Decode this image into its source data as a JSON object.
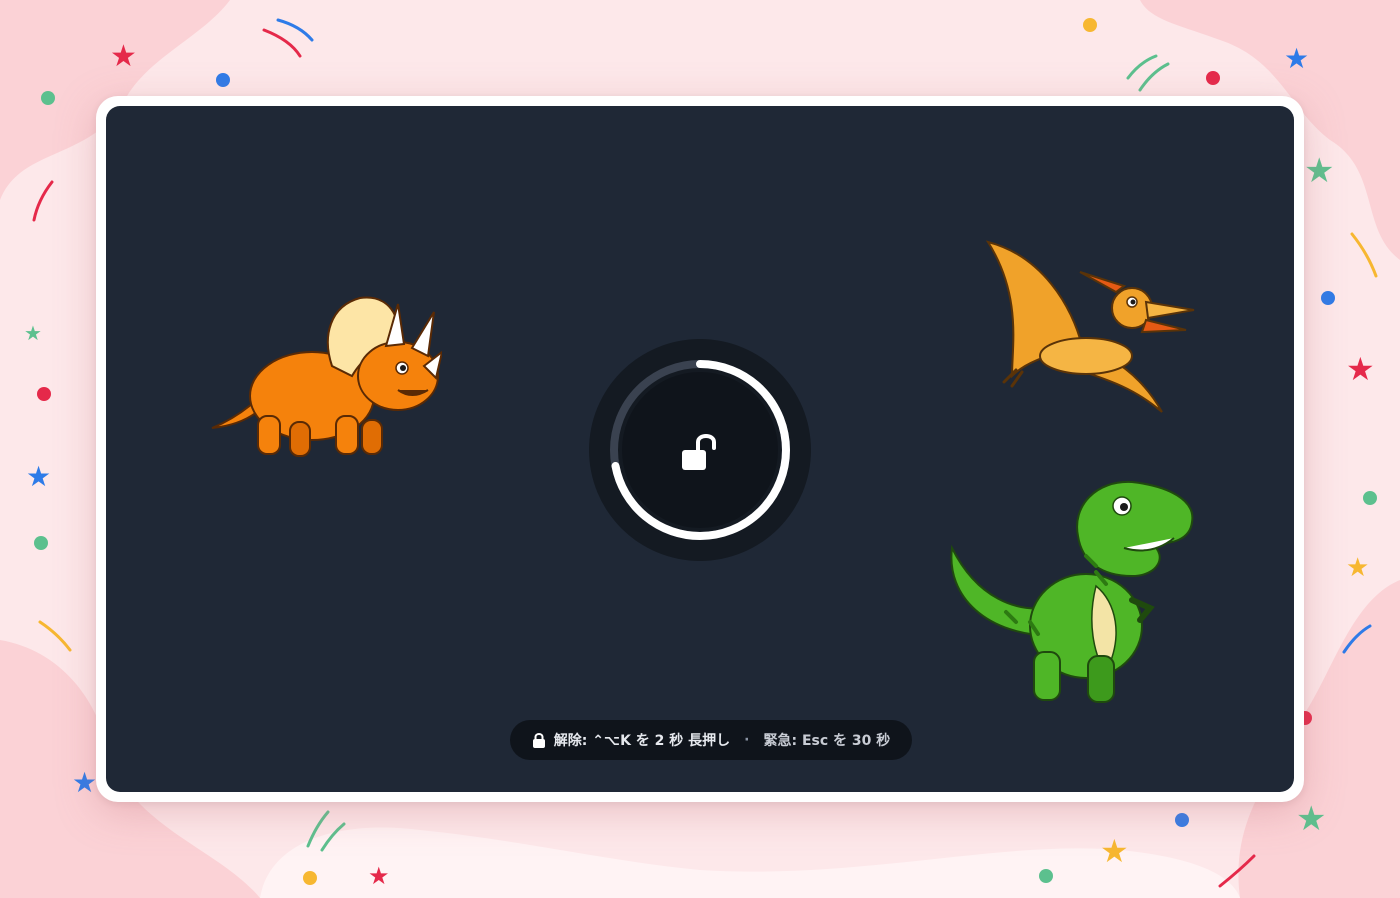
{
  "lock_screen": {
    "state": "locked",
    "unlock_progress": 0.72,
    "unlock_hint": {
      "label": "解除: ⌃⌥K を 2 秒 長押し",
      "separator": "·",
      "emergency": "緊急: Esc を 30 秒"
    }
  },
  "characters": [
    {
      "name": "triceratops",
      "color": "#f5820c"
    },
    {
      "name": "pteranodon",
      "color": "#f0a22a"
    },
    {
      "name": "t-rex",
      "color": "#4fb627"
    }
  ],
  "colors": {
    "wallpaper": "#fde8ea",
    "screen": "#1f2836",
    "ring_track": "#3a4250",
    "ring_progress": "#ffffff",
    "hint_pill": "#0f141b"
  }
}
